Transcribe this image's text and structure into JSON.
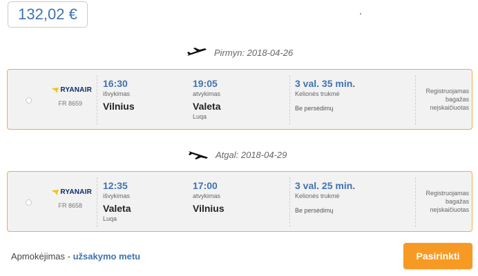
{
  "price": "132,02 €",
  "legs": [
    {
      "direction_label": "Pirmyn: 2018-04-26",
      "airline_name": "RYANAIR",
      "flight_number": "FR 8659",
      "departure_time": "16:30",
      "departure_label": "išvykimas",
      "departure_city": "Vilnius",
      "departure_airport": "",
      "arrival_time": "19:05",
      "arrival_label": "atvykimas",
      "arrival_city": "Valeta",
      "arrival_airport": "Luqa",
      "duration": "3 val. 35 min.",
      "duration_label": "Kelionės trukmė",
      "stops": "Be persėdimų",
      "baggage": "Registruojamas bagažas neįskaičiuotas"
    },
    {
      "direction_label": "Atgal: 2018-04-29",
      "airline_name": "RYANAIR",
      "flight_number": "FR 8658",
      "departure_time": "12:35",
      "departure_label": "išvykimas",
      "departure_city": "Valeta",
      "departure_airport": "Luqa",
      "arrival_time": "17:00",
      "arrival_label": "atvykimas",
      "arrival_city": "Vilnius",
      "arrival_airport": "",
      "duration": "3 val. 25 min.",
      "duration_label": "Kelionės trukmė",
      "stops": "Be persėdimų",
      "baggage": "Registruojamas bagažas neįskaičiuotas"
    }
  ],
  "footer": {
    "payment_label": "Apmokėjimas - ",
    "payment_link": "užsakymo metu",
    "select_button": "Pasirinkti"
  },
  "colors": {
    "accent_blue": "#3f72b1",
    "border_orange": "#f4a945",
    "button_orange": "#f79a23"
  }
}
